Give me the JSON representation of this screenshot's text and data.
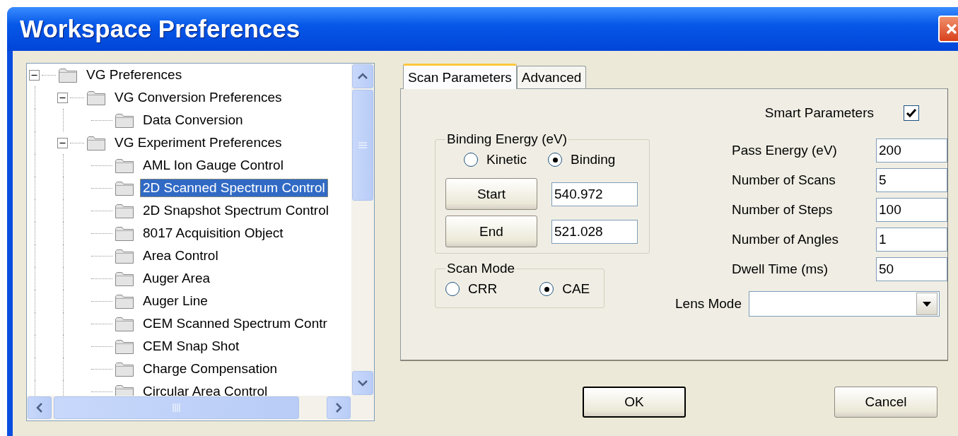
{
  "window": {
    "title": "Workspace Preferences"
  },
  "tree": [
    {
      "label": "VG Preferences",
      "expanded": true,
      "selected": false,
      "children": [
        {
          "label": "VG Conversion Preferences",
          "expanded": true,
          "selected": false,
          "children": [
            {
              "label": "Data Conversion",
              "selected": false
            }
          ]
        },
        {
          "label": "VG Experiment Preferences",
          "expanded": true,
          "selected": false,
          "children": [
            {
              "label": "AML Ion Gauge Control",
              "selected": false
            },
            {
              "label": "2D Scanned Spectrum Control",
              "selected": true
            },
            {
              "label": "2D Snapshot Spectrum Control",
              "selected": false
            },
            {
              "label": "8017 Acquisition Object",
              "selected": false
            },
            {
              "label": "Area Control",
              "selected": false
            },
            {
              "label": "Auger Area",
              "selected": false
            },
            {
              "label": "Auger Line",
              "selected": false
            },
            {
              "label": "CEM Scanned Spectrum Contr",
              "selected": false
            },
            {
              "label": "CEM Snap Shot",
              "selected": false
            },
            {
              "label": "Charge Compensation",
              "selected": false
            },
            {
              "label": "Circular Area Control",
              "selected": false
            }
          ]
        }
      ]
    }
  ],
  "tabs": [
    {
      "label": "Scan Parameters",
      "selected": true
    },
    {
      "label": "Advanced",
      "selected": false
    }
  ],
  "smart_parameters": {
    "label": "Smart Parameters",
    "checked": true
  },
  "binding_energy": {
    "title": "Binding Energy (eV)",
    "options": [
      {
        "label": "Kinetic",
        "selected": false
      },
      {
        "label": "Binding",
        "selected": true
      }
    ],
    "rows": [
      {
        "button": "Start",
        "value": "540.972"
      },
      {
        "button": "End",
        "value": "521.028"
      }
    ]
  },
  "scan_mode": {
    "title": "Scan Mode",
    "options": [
      {
        "label": "CRR",
        "selected": false
      },
      {
        "label": "CAE",
        "selected": true
      }
    ]
  },
  "parameters": [
    {
      "label": "Pass Energy (eV)",
      "value": "200"
    },
    {
      "label": "Number of Scans",
      "value": "5"
    },
    {
      "label": "Number of Steps",
      "value": "100"
    },
    {
      "label": "Number of Angles",
      "value": "1"
    },
    {
      "label": "Dwell Time (ms)",
      "value": "50"
    }
  ],
  "lens_mode": {
    "label": "Lens Mode"
  },
  "buttons": [
    {
      "label": "OK",
      "kind": "default"
    },
    {
      "label": "Cancel",
      "kind": "normal"
    }
  ]
}
